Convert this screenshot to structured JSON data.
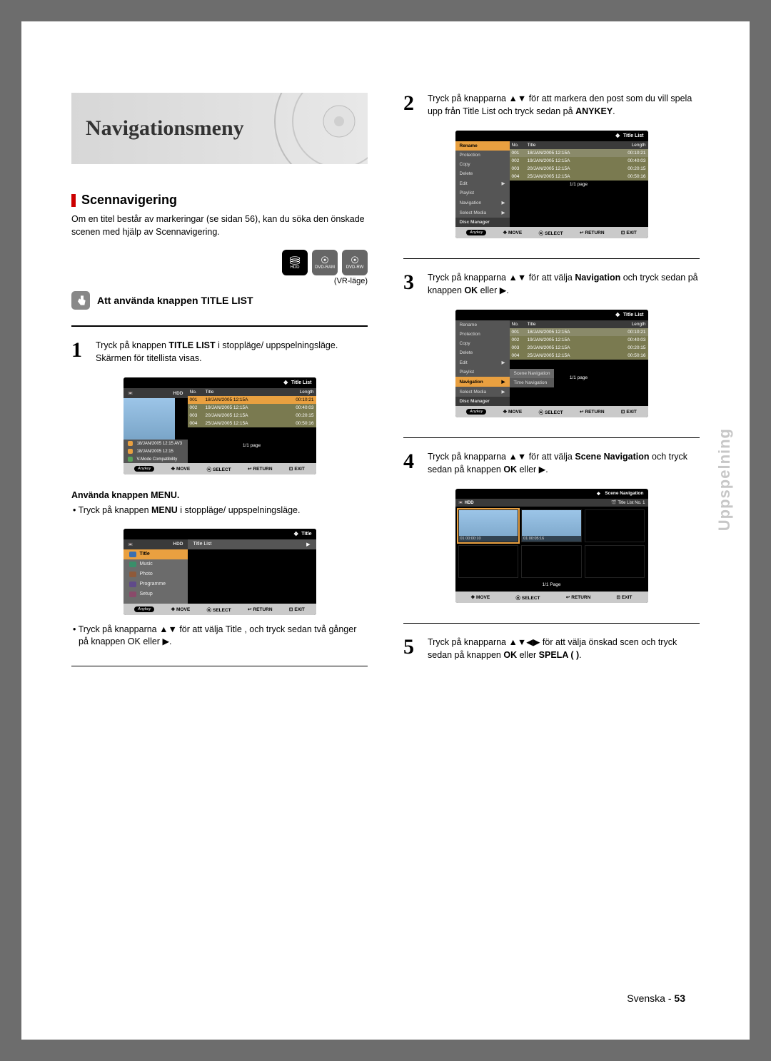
{
  "banner": {
    "title": "Navigationsmeny"
  },
  "section": {
    "title": "Scennavigering"
  },
  "intro": "Om en titel består av markeringar (se sidan 56), kan du söka den önskade scenen med hjälp av Scennavigering.",
  "disc_labels": {
    "hdd": "HDD",
    "ram": "DVD-RAM",
    "rw": "DVD-RW",
    "vr": "(VR-läge)"
  },
  "subtitle": "Att använda knappen TITLE LIST",
  "step1": {
    "pre": "Tryck på knappen ",
    "bold1": "TITLE LIST",
    "post": " i stoppläge/ uppspelningsläge. Skärmen för titellista visas."
  },
  "menu_use": "Använda knappen MENU.",
  "menu_bullet": {
    "pre": "• Tryck på knappen ",
    "bold": "MENU",
    "post": " i stoppläge/ uppspelningsläge."
  },
  "title_nav_bullet": "• Tryck på knapparna ▲▼ för att välja Title , och tryck sedan två gånger på knappen OK eller ▶.",
  "step2": {
    "line1": "Tryck på knapparna ▲▼ för att markera den post som du vill spela upp från Title List och tryck sedan på ",
    "bold": "ANYKEY",
    "end": "."
  },
  "step3": {
    "pre": "Tryck på knapparna ▲▼ för att välja ",
    "bold1": "Navigation",
    "mid": " och tryck sedan på knappen ",
    "bold2": "OK",
    "post": " eller ▶."
  },
  "step4": {
    "pre": "Tryck på knapparna ▲▼ för att välja ",
    "bold1": "Scene Navigation",
    "mid": " och tryck sedan på knappen ",
    "bold2": "OK",
    "post": " eller ▶."
  },
  "step5": {
    "pre": "Tryck på knapparna ▲▼◀▶ för att välja önskad scen och tryck sedan på knappen ",
    "bold1": "OK",
    "mid": " eller ",
    "bold2": "SPELA (   )",
    "post": "."
  },
  "osd_titlelist": {
    "title": "Title List",
    "hdd": "HDD",
    "cols": {
      "no": "No.",
      "title": "Title",
      "len": "Length"
    },
    "rows": [
      {
        "no": "001",
        "title": "18/JAN/2005 12:15A",
        "len": "00:10:21"
      },
      {
        "no": "002",
        "title": "19/JAN/2005 12:15A",
        "len": "00:40:03"
      },
      {
        "no": "003",
        "title": "20/JAN/2005 12:15A",
        "len": "00:20:15"
      },
      {
        "no": "004",
        "title": "25/JAN/2005 12:15A",
        "len": "00:50:16"
      }
    ],
    "meta1": "18/JAN/2005 12:15 AV3",
    "meta2": "18/JAN/2005 12:15",
    "meta3": "V-Mode Compatibility",
    "page": "1/1 page",
    "foot": {
      "anykey": "Anykey",
      "move": "MOVE",
      "select": "SELECT",
      "ret": "RETURN",
      "exit": "EXIT"
    }
  },
  "osd_menu": {
    "title": "Title",
    "hdd": "HDD",
    "items": [
      "Title",
      "Music",
      "Photo",
      "Programme",
      "Setup"
    ],
    "sub": "Title List"
  },
  "osd_ctx": {
    "items": [
      "Rename",
      "Protection",
      "Copy",
      "Delete",
      "Edit",
      "Playlist",
      "Navigation",
      "Select Media",
      "Disc Manager"
    ]
  },
  "osd_ctx_nav": {
    "subs": [
      "Scene Navigation",
      "Time Navigation"
    ]
  },
  "osd_scene": {
    "title": "Scene Navigation",
    "sub": "Title List  No.  1",
    "cells": [
      "01  00:00:10",
      "01  00:05:16"
    ],
    "page": "1/1 Page"
  },
  "sidetab": "Uppspelning",
  "footer": {
    "lang": "Svenska",
    "sep": " - ",
    "page": "53"
  }
}
